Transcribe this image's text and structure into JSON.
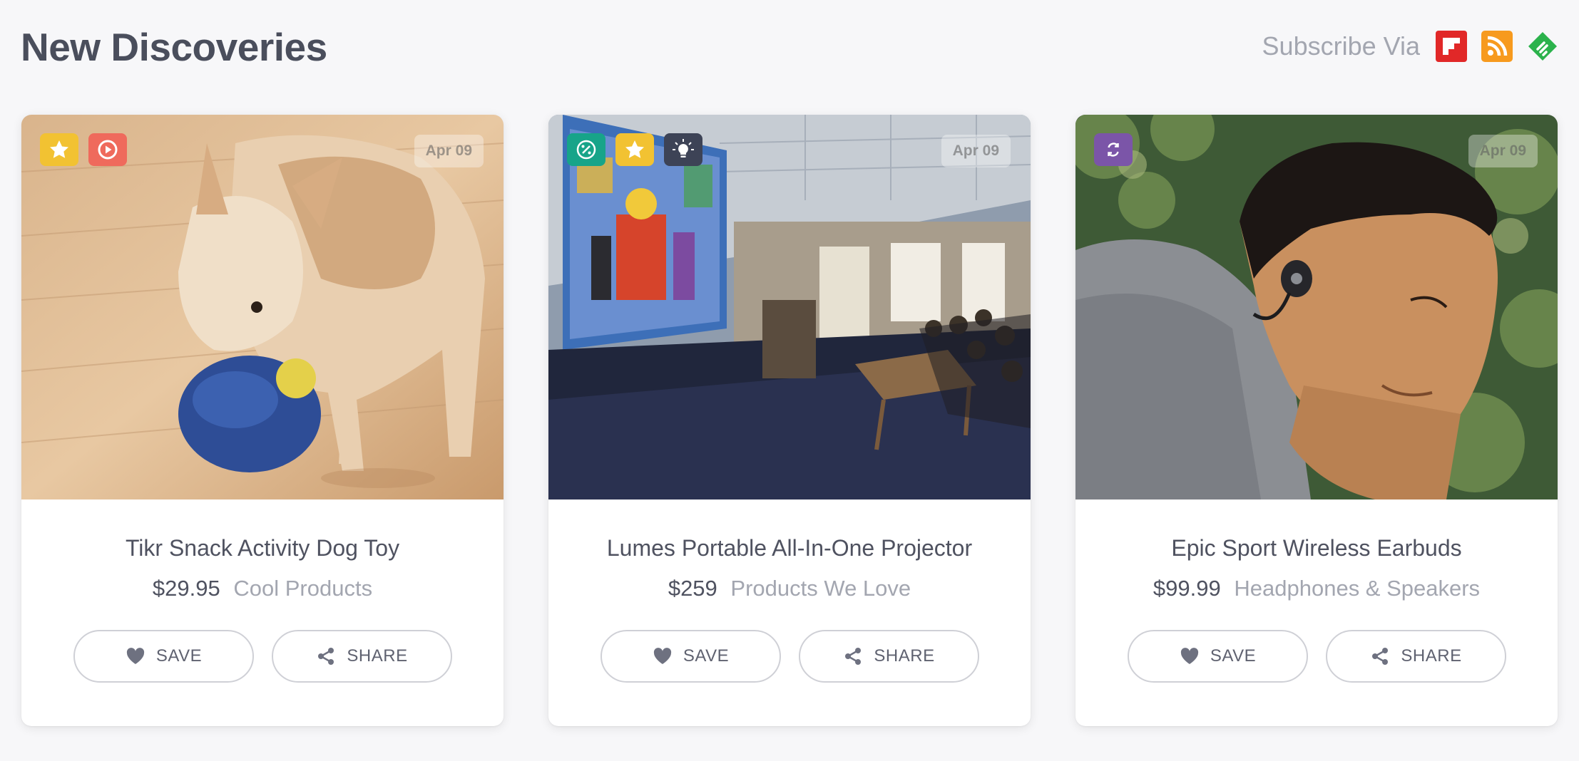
{
  "page": {
    "title": "New Discoveries",
    "subscribe_label": "Subscribe Via",
    "subscribe_icons": [
      {
        "name": "flipboard-icon",
        "color": "#e12828"
      },
      {
        "name": "rss-icon",
        "color": "#f79a1e"
      },
      {
        "name": "feedly-icon",
        "color": "#2bb24c"
      }
    ]
  },
  "cards": [
    {
      "date": "Apr 09",
      "name": "Tikr Snack Activity Dog Toy",
      "price": "$29.95",
      "category": "Cool Products",
      "badges": [
        {
          "icon": "star-icon",
          "color": "#f2c232"
        },
        {
          "icon": "play-icon",
          "color": "#ef6a5c"
        }
      ],
      "save_label": "SAVE",
      "share_label": "SHARE"
    },
    {
      "date": "Apr 09",
      "name": "Lumes Portable All-In-One Projector",
      "price": "$259",
      "category": "Products We Love",
      "badges": [
        {
          "icon": "percent-icon",
          "color": "#17a489"
        },
        {
          "icon": "star-icon",
          "color": "#f2c232"
        },
        {
          "icon": "lightbulb-icon",
          "color": "#3d4356"
        }
      ],
      "save_label": "SAVE",
      "share_label": "SHARE"
    },
    {
      "date": "Apr 09",
      "name": "Epic Sport Wireless Earbuds",
      "price": "$99.99",
      "category": "Headphones & Speakers",
      "badges": [
        {
          "icon": "refresh-icon",
          "color": "#7b55a8"
        }
      ],
      "save_label": "SAVE",
      "share_label": "SHARE"
    }
  ]
}
